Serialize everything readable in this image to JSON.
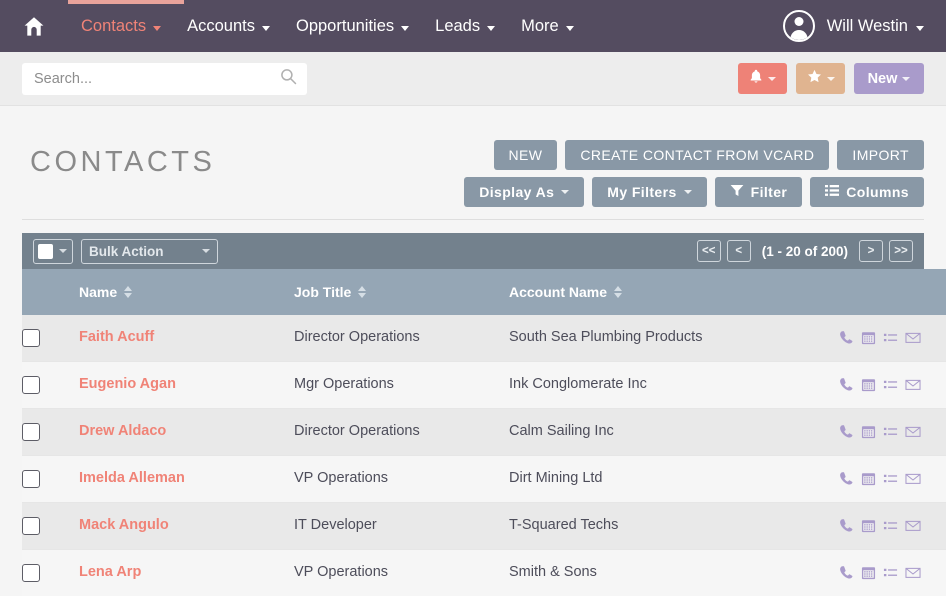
{
  "navbar": {
    "home_icon": "home-icon",
    "items": [
      {
        "label": "Contacts",
        "active": true
      },
      {
        "label": "Accounts",
        "active": false
      },
      {
        "label": "Opportunities",
        "active": false
      },
      {
        "label": "Leads",
        "active": false
      },
      {
        "label": "More",
        "active": false
      }
    ],
    "user": {
      "name": "Will Westin",
      "avatar_icon": "user-avatar-icon"
    },
    "background_color": "#544C60",
    "active_color": "#F08377"
  },
  "search": {
    "placeholder": "Search...",
    "value": "",
    "icon": "search-icon"
  },
  "quick_actions": {
    "alert": {
      "icon": "bell-icon",
      "color": "#EE8277"
    },
    "favorite": {
      "icon": "star-icon",
      "color": "#E0B490"
    },
    "new": {
      "label": "New",
      "color": "#A99BCB"
    }
  },
  "page": {
    "title": "CONTACTS",
    "primary_actions": [
      {
        "label": "NEW",
        "name": "new-button"
      },
      {
        "label": "CREATE CONTACT FROM VCARD",
        "name": "create-contact-from-vcard-button"
      },
      {
        "label": "IMPORT",
        "name": "import-button"
      }
    ],
    "secondary_actions": [
      {
        "label": "Display As",
        "name": "display-as-button",
        "caret": true,
        "icon": ""
      },
      {
        "label": "My Filters",
        "name": "my-filters-button",
        "caret": true,
        "icon": ""
      },
      {
        "label": "Filter",
        "name": "filter-button",
        "caret": false,
        "icon": "funnel-icon"
      },
      {
        "label": "Columns",
        "name": "columns-button",
        "caret": false,
        "icon": "list-icon"
      }
    ]
  },
  "bulk_bar": {
    "select_all_checkbox": "select-all-checkbox",
    "bulk_action_label": "Bulk Action",
    "pager": {
      "first": "<<",
      "prev": "<",
      "count": "(1 - 20 of 200)",
      "next": ">",
      "last": ">>"
    }
  },
  "table": {
    "columns": [
      {
        "label": "",
        "name": "checkbox-column"
      },
      {
        "label": "Name",
        "name": "name-column",
        "sortable": true
      },
      {
        "label": "Job Title",
        "name": "job-title-column",
        "sortable": true
      },
      {
        "label": "Account Name",
        "name": "account-name-column",
        "sortable": true
      },
      {
        "label": "",
        "name": "actions-column"
      }
    ],
    "row_icons": [
      "phone-icon",
      "calendar-icon",
      "list-icon",
      "envelope-icon"
    ],
    "rows": [
      {
        "name": "Faith Acuff",
        "job_title": "Director Operations",
        "account_name": "South Sea Plumbing Products"
      },
      {
        "name": "Eugenio Agan",
        "job_title": "Mgr Operations",
        "account_name": "Ink Conglomerate Inc"
      },
      {
        "name": "Drew Aldaco",
        "job_title": "Director Operations",
        "account_name": "Calm Sailing Inc"
      },
      {
        "name": "Imelda Alleman",
        "job_title": "VP Operations",
        "account_name": "Dirt Mining Ltd"
      },
      {
        "name": "Mack Angulo",
        "job_title": "IT Developer",
        "account_name": "T-Squared Techs"
      },
      {
        "name": "Lena Arp",
        "job_title": "VP Operations",
        "account_name": "Smith &amp; Sons"
      }
    ]
  }
}
